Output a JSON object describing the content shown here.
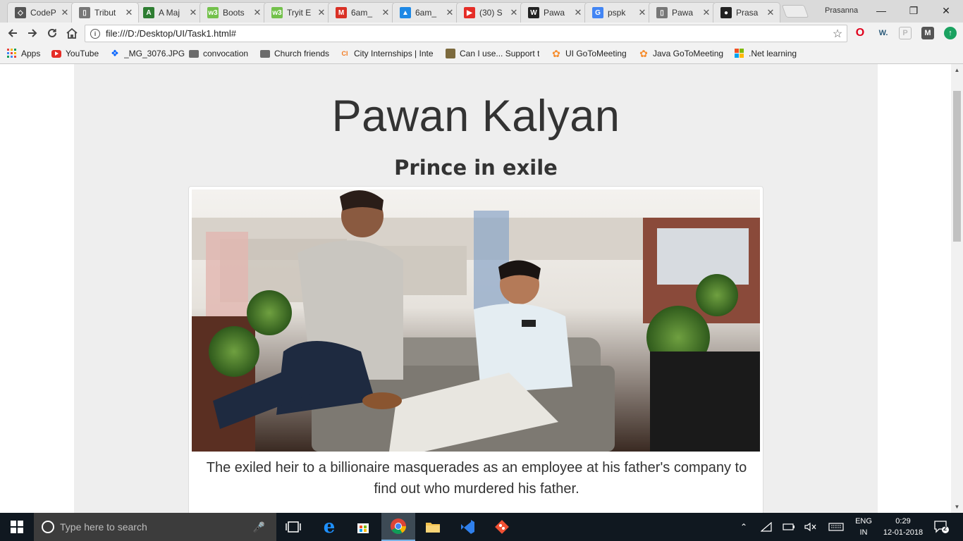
{
  "tabs": [
    {
      "title": "CodeP",
      "icon": "codepen-icon",
      "color": "#555555"
    },
    {
      "title": "Tribut",
      "icon": "document-icon",
      "color": "#777777"
    },
    {
      "title": "A Maj",
      "icon": "spreadsheet-icon",
      "color": "#2e7d32"
    },
    {
      "title": "Boots",
      "icon": "w3-icon",
      "color": "#73c14b"
    },
    {
      "title": "Tryit E",
      "icon": "w3-icon",
      "color": "#73c14b"
    },
    {
      "title": "6am_",
      "icon": "gmail-icon",
      "color": "#d93025"
    },
    {
      "title": "6am_",
      "icon": "drive-icon",
      "color": "#1e88e5"
    },
    {
      "title": "(30) S",
      "icon": "youtube-icon",
      "color": "#e52d27"
    },
    {
      "title": "Pawa",
      "icon": "wikipedia-icon",
      "color": "#222222"
    },
    {
      "title": "pspk",
      "icon": "google-icon",
      "color": "#4285f4"
    },
    {
      "title": "Pawa",
      "icon": "document-icon",
      "color": "#777777"
    },
    {
      "title": "Prasa",
      "icon": "github-icon",
      "color": "#222222"
    }
  ],
  "active_tab_index": 1,
  "profile_name": "Prasanna",
  "address_bar": {
    "url": "file:///D:/Desktop/UI/Task1.html#"
  },
  "bookmarks": [
    {
      "label": "Apps",
      "icon": "apps-grid-icon"
    },
    {
      "label": "YouTube",
      "icon": "youtube-icon"
    },
    {
      "label": "_MG_3076.JPG",
      "icon": "dropbox-icon"
    },
    {
      "label": "convocation",
      "icon": "folder-icon"
    },
    {
      "label": "Church friends",
      "icon": "folder-icon"
    },
    {
      "label": "City Internships | Inte",
      "icon": "ci-icon"
    },
    {
      "label": "Can I use... Support t",
      "icon": "caniuse-icon"
    },
    {
      "label": "UI GoToMeeting",
      "icon": "gotomeeting-icon"
    },
    {
      "label": "Java GoToMeeting",
      "icon": "gotomeeting-icon"
    },
    {
      ".label_note": "",
      "label": ".Net learning",
      "icon": "windows-icon"
    }
  ],
  "page": {
    "title": "Pawan Kalyan",
    "subtitle": "Prince in exile",
    "image_alt": "photo-of-two-men-on-sofa",
    "caption": "The exiled heir to a billionaire masquerades as an employee at his father's company to find out who murdered his father."
  },
  "taskbar": {
    "search_placeholder": "Type here to search",
    "language_top": "ENG",
    "language_bottom": "IN",
    "time": "0:29",
    "date": "12-01-2018",
    "notification_count": "2"
  }
}
